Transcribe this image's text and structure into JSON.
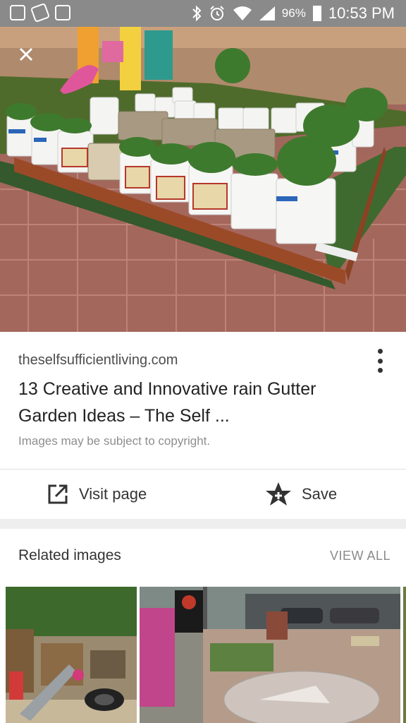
{
  "status_bar": {
    "battery": "96%",
    "time": "10:53 PM"
  },
  "result": {
    "domain": "theselfsufficientliving.com",
    "title": "13 Creative and Innovative rain Gutter Garden Ideas – The Self ...",
    "copyright_note": "Images may be subject to copyright."
  },
  "actions": {
    "visit_label": "Visit page",
    "save_label": "Save"
  },
  "related": {
    "heading": "Related images",
    "view_all": "VIEW ALL"
  },
  "icons": {
    "close": "close-icon",
    "more": "more-vert-icon",
    "visit": "open-in-new-icon",
    "save": "star-add-icon"
  },
  "colors": {
    "status_bar": "#8a8a8a",
    "page_bg": "#ffffff",
    "section_gap": "#eeeeee"
  }
}
